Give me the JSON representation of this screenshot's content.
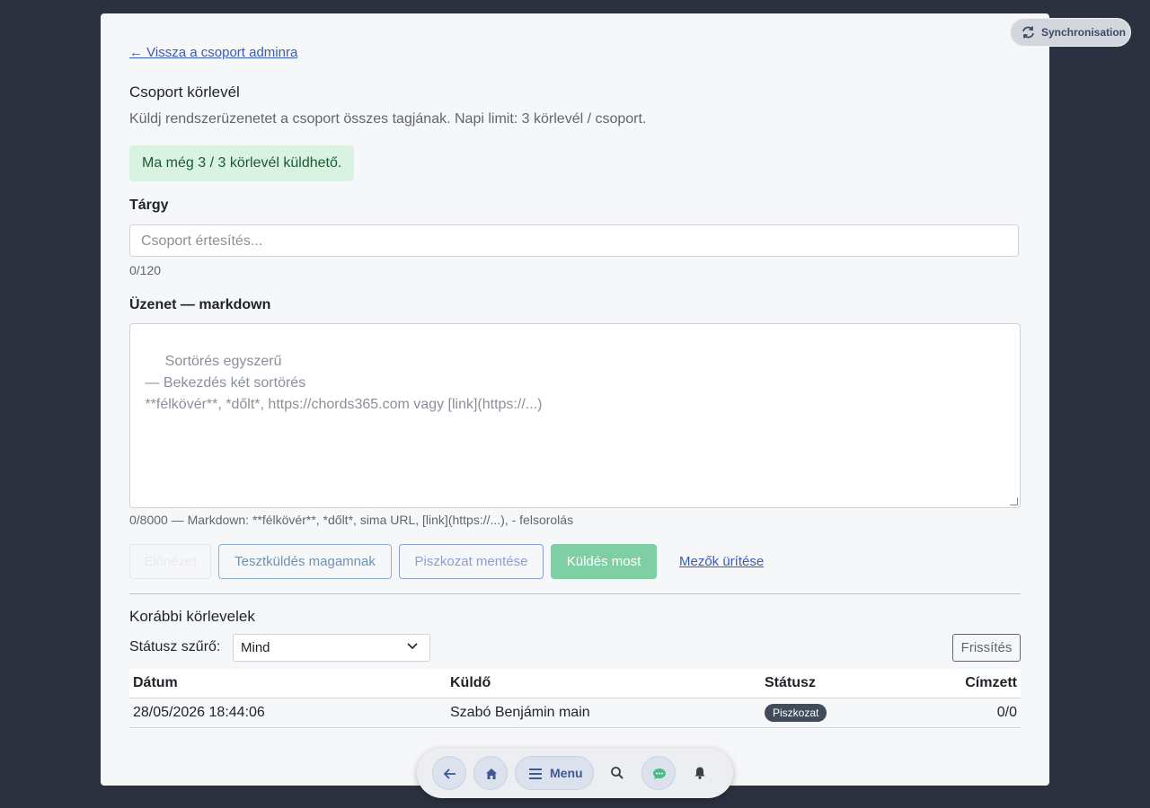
{
  "nav": {
    "back_link": "← Vissza a csoport adminra"
  },
  "header": {
    "title": "Csoport körlevél",
    "subtitle": "Küldj rendszerüzenetet a csoport összes tagjának. Napi limit: 3 körlevél / csoport."
  },
  "quota": {
    "text": "Ma még 3 / 3 körlevél küldhető."
  },
  "subject": {
    "label": "Tárgy",
    "placeholder": "Csoport értesítés...",
    "value": "",
    "counter": "0/120"
  },
  "message": {
    "label": "Üzenet — markdown",
    "placeholder": "Sortörés egyszerű\n — Bekezdés két sortörés\n **félkövér**, *dőlt*, https://chords365.com vagy [link](https://...)",
    "counter": "0/8000 — Markdown: **félkövér**, *dőlt*, sima URL, [link](https://...), - felsorolás"
  },
  "actions": {
    "preview": "Előnézet",
    "test_send": "Tesztküldés magamnak",
    "save_draft": "Piszkozat mentése",
    "send_now": "Küldés most",
    "clear_fields": "Mezők ürítése"
  },
  "history": {
    "title": "Korábbi körlevelek",
    "filter_label": "Státusz szűrő:",
    "filter_value": "Mind",
    "refresh": "Frissítés",
    "columns": [
      "Dátum",
      "Küldő",
      "Státusz",
      "Címzett"
    ],
    "rows": [
      {
        "date": "28/05/2026 18:44:06",
        "sender": "Szabó Benjámin main",
        "status": "Piszkozat",
        "recipients": "0/0"
      }
    ]
  },
  "sync": {
    "label": "Synchronisation"
  },
  "dock": {
    "menu_label": "Menu"
  },
  "colors": {
    "accent": "#3b5bb5",
    "send": "#7fcfa4",
    "quota_bg": "#d9f3e2",
    "badge_bg": "#414b5a"
  }
}
